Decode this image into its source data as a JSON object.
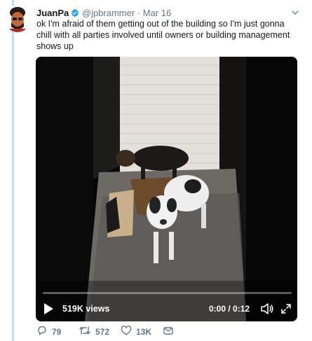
{
  "tweet": {
    "display_name": "JuanPa",
    "handle": "@jpbrammer",
    "separator": "·",
    "date": "Mar 16",
    "text": "ok I'm afraid of them getting out of the building so I'm just gonna chill with all parties involved until owners or building management shows up"
  },
  "video": {
    "views": "519K views",
    "time": "0:00 / 0:12",
    "progress": 0
  },
  "actions": {
    "replies": "79",
    "retweets": "572",
    "likes": "13K"
  },
  "colors": {
    "accent": "#1da1f2",
    "thread_line": "#c4dff2",
    "muted_text": "#657786"
  },
  "icons": [
    "verified-badge-icon",
    "chevron-down-icon",
    "play-icon",
    "volume-icon",
    "fullscreen-icon",
    "reply-icon",
    "retweet-icon",
    "like-icon",
    "direct-message-icon"
  ]
}
